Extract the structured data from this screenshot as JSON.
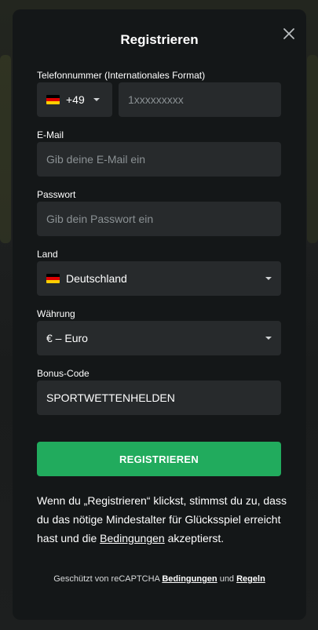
{
  "modal": {
    "title": "Registrieren"
  },
  "form": {
    "phone": {
      "label": "Telefonnummer (Internationales Format)",
      "country_code": "+49",
      "placeholder": "1xxxxxxxxx"
    },
    "email": {
      "label": "E-Mail",
      "placeholder": "Gib deine E-Mail ein"
    },
    "password": {
      "label": "Passwort",
      "placeholder": "Gib dein Passwort ein"
    },
    "country": {
      "label": "Land",
      "value": "Deutschland"
    },
    "currency": {
      "label": "Währung",
      "value": "€ – Euro"
    },
    "bonus_code": {
      "label": "Bonus-Code",
      "value": "SPORTWETTENHELDEN"
    }
  },
  "register_button": "REGISTRIEREN",
  "consent": {
    "text_before": "Wenn du „Registrieren“ klickst, stimmst du zu, dass du das nötige Mindestalter für Glücksspiel erreicht hast und die ",
    "link": "Bedingungen",
    "text_after": " akzeptierst."
  },
  "recaptcha": {
    "text_before": "Geschützt von reCAPTCHA ",
    "terms_link": "Bedingungen",
    "and": " und ",
    "rules_link": "Regeln"
  },
  "colors": {
    "accent_green": "#21ab5d",
    "modal_bg": "#141718",
    "input_bg": "#272a2c"
  },
  "icons": {
    "close": "close-icon",
    "flag": "germany-flag-icon",
    "dropdown": "chevron-down-icon"
  }
}
